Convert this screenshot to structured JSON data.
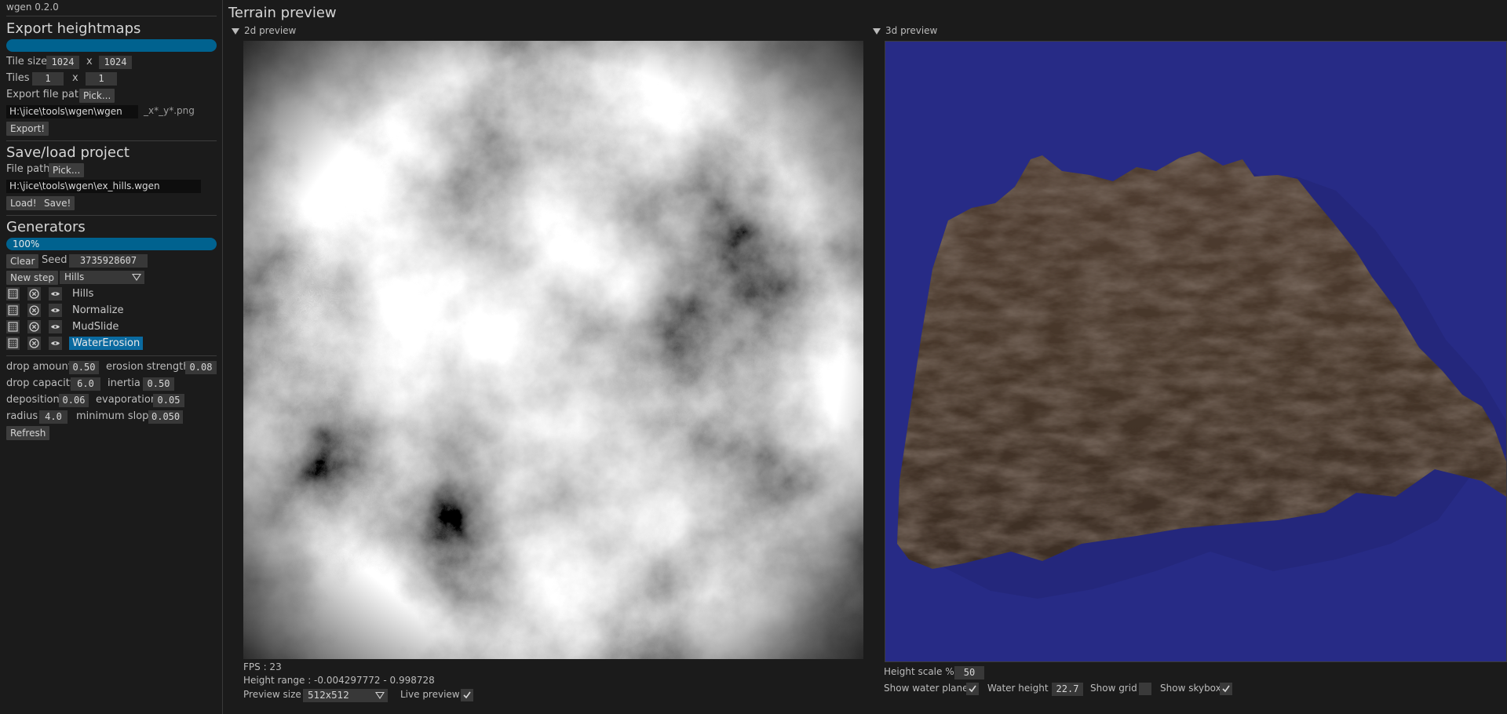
{
  "app": {
    "title": "wgen 0.2.0"
  },
  "export": {
    "heading": "Export heightmaps",
    "tile_size_label": "Tile size",
    "tile_w": "1024",
    "tile_x": "x",
    "tile_h": "1024",
    "tiles_label": "Tiles",
    "tiles_x": "1",
    "tiles_sep": "x",
    "tiles_y": "1",
    "path_label": "Export file path",
    "pick_label": "Pick...",
    "path_value": "H:\\jice\\tools\\wgen\\wgen",
    "suffix": "_x*_y*.png",
    "export_button": "Export!"
  },
  "project": {
    "heading": "Save/load project",
    "file_path_label": "File path",
    "pick_label": "Pick...",
    "path_value": "H:\\jice\\tools\\wgen\\ex_hills.wgen",
    "load_button": "Load!",
    "save_button": "Save!"
  },
  "generators": {
    "heading": "Generators",
    "progress_text": "100%",
    "clear_button": "Clear",
    "seed_label": "Seed",
    "seed_value": "3735928607",
    "new_step_button": "New step",
    "step_type_selected": "Hills",
    "steps": [
      {
        "name": "Hills",
        "selected": false
      },
      {
        "name": "Normalize",
        "selected": false
      },
      {
        "name": "MudSlide",
        "selected": false
      },
      {
        "name": "WaterErosion",
        "selected": true
      }
    ],
    "params": {
      "drop_amount_label": "drop amount",
      "drop_amount": "0.50",
      "erosion_strength_label": "erosion strength",
      "erosion_strength": "0.08",
      "drop_capacity_label": "drop capacity",
      "drop_capacity": "6.0",
      "inertia_label": "inertia",
      "inertia": "0.50",
      "deposition_label": "deposition",
      "deposition": "0.06",
      "evaporation_label": "evaporation",
      "evaporation": "0.05",
      "radius_label": "radius",
      "radius": "4.0",
      "minimum_slope_label": "minimum slope",
      "minimum_slope": "0.050"
    },
    "refresh_button": "Refresh"
  },
  "preview": {
    "title": "Terrain preview",
    "panel2d_label": "2d preview",
    "panel3d_label": "3d preview",
    "fps_text": "FPS : 23",
    "height_range_text": "Height range : -0.004297772 - 0.998728",
    "preview_size_label": "Preview size",
    "preview_size_value": "512x512",
    "live_preview_label": "Live preview",
    "live_preview_checked": true,
    "height_scale_label": "Height scale %",
    "height_scale_value": "50",
    "show_water_label": "Show water plane",
    "show_water_checked": true,
    "water_height_label": "Water height",
    "water_height_value": "22.7",
    "show_grid_label": "Show grid",
    "show_grid_checked": false,
    "show_skybox_label": "Show skybox",
    "show_skybox_checked": true
  },
  "colors": {
    "accent": "#00628f",
    "selection": "#0a6aa0",
    "sky": "#272b86",
    "terrain": "#4a3a30",
    "background": "#1b1b1b"
  },
  "icons": [
    "disable-icon",
    "delete-icon",
    "visibility-eye-icon",
    "checkmark-icon",
    "collapse-triangle-icon",
    "dropdown-arrow-icon"
  ]
}
